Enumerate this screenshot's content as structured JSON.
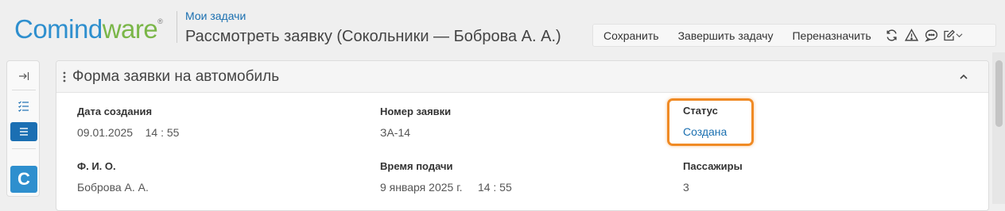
{
  "brand": {
    "part1": "Comind",
    "part2": "ware",
    "reg": "®"
  },
  "breadcrumb": "Мои задачи",
  "page_title": "Рассмотреть заявку (Сокольники — Боброва А. А.)",
  "toolbar": {
    "save": "Сохранить",
    "complete": "Завершить задачу",
    "reassign": "Переназначить",
    "icons": [
      "refresh-icon",
      "warning-icon",
      "chat-icon",
      "edit-icon",
      "chevron-down-icon"
    ]
  },
  "rail": {
    "icons": [
      "collapse-panel-icon",
      "checklist-icon",
      "list-icon"
    ],
    "avatar_letter": "C"
  },
  "form": {
    "title": "Форма заявки на автомобиль",
    "fields": {
      "created_label": "Дата создания",
      "created_date": "09.01.2025",
      "created_time": "14 : 55",
      "number_label": "Номер заявки",
      "number_value": "ЗА-14",
      "status_label": "Статус",
      "status_value": "Создана",
      "fio_label": "Ф. И. О.",
      "fio_value": "Боброва А. А.",
      "time_label": "Время подачи",
      "time_date": "9 января 2025 г.",
      "time_time": "14 : 55",
      "passengers_label": "Пассажиры",
      "passengers_value": "3"
    }
  },
  "colors": {
    "accent": "#1b6fb3",
    "brand_blue": "#2e8fce",
    "brand_green": "#7ab648",
    "highlight": "#f08a24"
  }
}
